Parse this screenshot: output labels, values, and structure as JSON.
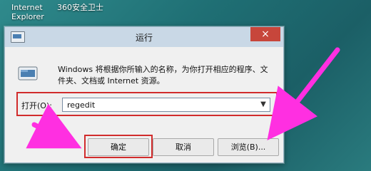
{
  "desktop": {
    "icons": [
      {
        "label": "Internet Explorer"
      },
      {
        "label": "360安全卫士"
      }
    ]
  },
  "dialog": {
    "title": "运行",
    "close_label": "×",
    "prompt": "Windows 将根据你所输入的名称，为你打开相应的程序、文件夹、文档或 Internet 资源。",
    "open_label": "打开(O):",
    "input_value": "regedit",
    "buttons": {
      "ok": "确定",
      "cancel": "取消",
      "browse": "浏览(B)..."
    }
  },
  "colors": {
    "highlight": "#d12c2c",
    "arrow": "#ff2fe1",
    "close": "#c7463b"
  },
  "icons": {
    "title": "run-dialog-icon",
    "content": "run-program-icon",
    "dropdown": "chevron-down-icon"
  }
}
